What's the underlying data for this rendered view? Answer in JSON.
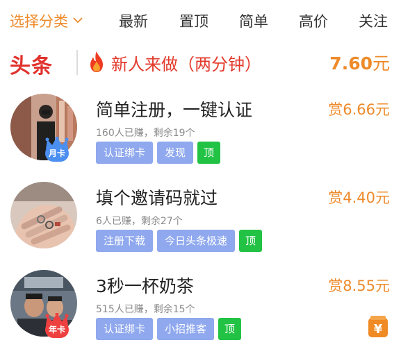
{
  "tabs": [
    {
      "label": "选择分类",
      "active": true
    },
    {
      "label": "最新"
    },
    {
      "label": "置顶"
    },
    {
      "label": "简单"
    },
    {
      "label": "高价"
    },
    {
      "label": "关注"
    }
  ],
  "banner": {
    "logo": "头条",
    "title": "新人来做（两分钟）",
    "price": "7.60",
    "price_unit": "元"
  },
  "tasks": [
    {
      "title": "简单注册，一键认证",
      "reward": "赏6.66元",
      "meta": "160人已赚，剩余19个",
      "badge": "月卡",
      "tags": [
        "认证绑卡",
        "发现",
        "顶"
      ]
    },
    {
      "title": "填个邀请码就过",
      "reward": "赏4.40元",
      "meta": "6人已赚，剩余27个",
      "badge": "",
      "tags": [
        "注册下载",
        "今日头条极速",
        "顶"
      ]
    },
    {
      "title": "3秒一杯奶茶",
      "reward": "赏8.55元",
      "meta": "515人已赚，剩余15个",
      "badge": "年卡",
      "tags": [
        "认证绑卡",
        "小招推客",
        "顶"
      ]
    }
  ],
  "colors": {
    "accent_orange": "#ee8a2a",
    "brand_red": "#e1322d",
    "tag_blue": "#8fa8ee",
    "tag_green": "#22c245",
    "crown_blue": "#4b8ff0",
    "crown_red": "#ef4040"
  },
  "icons": [
    "chevron-down-icon",
    "flame-icon",
    "crown-icon",
    "yuan-icon"
  ]
}
